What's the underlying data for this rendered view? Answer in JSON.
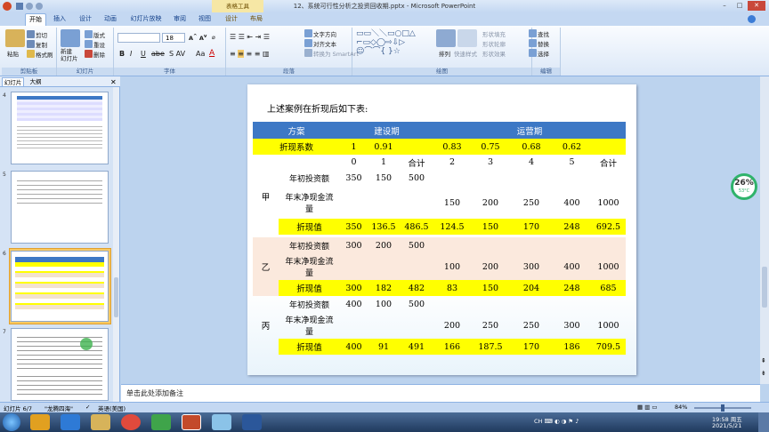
{
  "window": {
    "title": "12、系统可行性分析之投资回收期.pptx - Microsoft PowerPoint",
    "context_tab": "表格工具"
  },
  "tabs": [
    "开始",
    "插入",
    "设计",
    "动画",
    "幻灯片放映",
    "审阅",
    "视图",
    "设计",
    "布局"
  ],
  "ribbon": {
    "clipboard": {
      "label": "剪贴板",
      "paste": "粘贴",
      "cut": "剪切",
      "copy": "复制",
      "format_painter": "格式刷"
    },
    "slides": {
      "label": "幻灯片",
      "new_slide": "新建\n幻灯片",
      "layout": "版式",
      "reset": "重设",
      "delete": "删除"
    },
    "font": {
      "label": "字体",
      "size": "18"
    },
    "paragraph": {
      "label": "段落",
      "text_direction": "文字方向",
      "align_text": "对齐文本",
      "smartart": "转换为 SmartArt"
    },
    "drawing": {
      "label": "绘图",
      "arrange": "排列",
      "quick_styles": "快速样式",
      "shape_fill": "形状填充",
      "shape_outline": "形状轮廓",
      "shape_effects": "形状效果"
    },
    "editing": {
      "label": "编辑",
      "find": "查找",
      "replace": "替换",
      "select": "选择"
    }
  },
  "side_panel": {
    "tab_slides": "幻灯片",
    "tab_outline": "大纲",
    "numbers": [
      "4",
      "5",
      "6",
      "7"
    ]
  },
  "slide": {
    "title": "上述案例在折现后如下表:",
    "header": [
      "方案",
      "建设期",
      "运营期"
    ],
    "discount_label": "折现系数",
    "discount": [
      "1",
      "0.91",
      "",
      "0.83",
      "0.75",
      "0.68",
      "0.62",
      ""
    ],
    "years": [
      "0",
      "1",
      "合计",
      "2",
      "3",
      "4",
      "5",
      "合计"
    ],
    "plans": [
      {
        "name": "甲",
        "rows": [
          {
            "label": "年初投资额",
            "values": [
              "350",
              "150",
              "500",
              "",
              "",
              "",
              "",
              ""
            ]
          },
          {
            "label": "年末净现金流量",
            "values": [
              "",
              "",
              "",
              "150",
              "200",
              "250",
              "400",
              "1000"
            ]
          },
          {
            "label": "折现值",
            "values": [
              "350",
              "136.5",
              "486.5",
              "124.5",
              "150",
              "170",
              "248",
              "692.5"
            ]
          }
        ]
      },
      {
        "name": "乙",
        "rows": [
          {
            "label": "年初投资额",
            "values": [
              "300",
              "200",
              "500",
              "",
              "",
              "",
              "",
              ""
            ]
          },
          {
            "label": "年末净现金流量",
            "values": [
              "",
              "",
              "",
              "100",
              "200",
              "300",
              "400",
              "1000"
            ]
          },
          {
            "label": "折现值",
            "values": [
              "300",
              "182",
              "482",
              "83",
              "150",
              "204",
              "248",
              "685"
            ]
          }
        ]
      },
      {
        "name": "丙",
        "rows": [
          {
            "label": "年初投资额",
            "values": [
              "400",
              "100",
              "500",
              "",
              "",
              "",
              "",
              ""
            ]
          },
          {
            "label": "年末净现金流量",
            "values": [
              "",
              "",
              "",
              "200",
              "250",
              "250",
              "300",
              "1000"
            ]
          },
          {
            "label": "折现值",
            "values": [
              "400",
              "91",
              "491",
              "166",
              "187.5",
              "170",
              "186",
              "709.5"
            ]
          }
        ]
      }
    ]
  },
  "notes_placeholder": "单击此处添加备注",
  "status": {
    "slide": "幻灯片 6/7",
    "theme": "\"龙腾四海\"",
    "language": "英语(美国)",
    "zoom": "84%"
  },
  "gauge": {
    "percent": "26%",
    "temp": "53°C"
  },
  "clock": {
    "time": "19:58 周五",
    "date": "2021/5/21"
  },
  "colors": {
    "header_blue": "#3d78c5",
    "highlight_yellow": "#ffff00",
    "ribbon_blue": "#c4d8f2"
  }
}
